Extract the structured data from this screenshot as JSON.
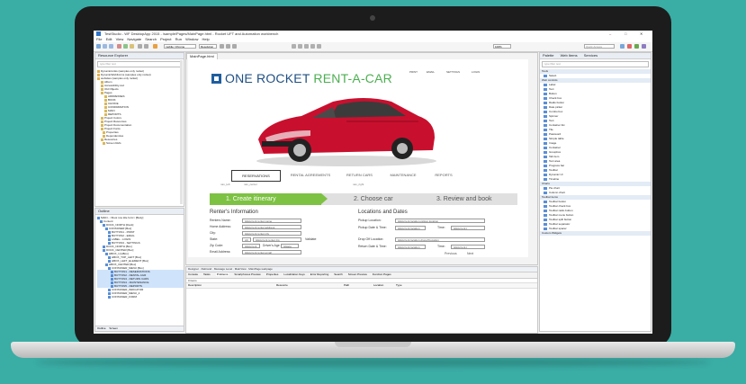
{
  "window": {
    "title": "TestStudio - WF DesktopApp 2015 - /sample/Pages/MainPage.html - Rocket UFT and Automation workbench",
    "controls": [
      "–",
      "□",
      "✕"
    ]
  },
  "menu": [
    "File",
    "Edit",
    "View",
    "Navigate",
    "Search",
    "Project",
    "Run",
    "Window",
    "Help"
  ],
  "toolbar": {
    "browser": "mobile: Chrome",
    "resolution": "Resolution",
    "zoom": "100%",
    "quick_access": "Quick Access"
  },
  "resource_explorer": {
    "title": "Resource Explorer",
    "search_placeholder": "type filter text",
    "items": [
      "DynamicLinks (samples only rocket)",
      "DynamicWebForms (samples only rocket)",
      "websites (samples only rocket)",
      "Album",
      "Accessibility.xsd",
      "Old Objects",
      "Pages",
      "ADDRESSES",
      "BOOK",
      "CHOICE",
      "CONFIRMATION",
      "MAIN",
      "REPORTS",
      "Project Colors",
      "Project Resources",
      "Project Documentation",
      "Project Fonts",
      "Properties",
      "Dependencies",
      "Resources",
      "Screen Refs"
    ]
  },
  "outline": {
    "title": "Outline",
    "items": [
      "MAIN - <Root row title form> [Body]",
      "Content",
      "DOCK_NORTH [Dock]",
      "CONTAINER [Box]",
      "BUTTON1 - PRINT",
      "BUTTON2 - EMAIL",
      "LABEL - LOGIN",
      "BUTTON3 - SETTINGS",
      "DOCK_NORTH [Box]",
      "DOCK_CENTER [Box]",
      "HBOX_1 [HBox]",
      "HBOX_TOP_LEFT [Box]",
      "HBOX_LEFT_ELEMENT [Box]",
      "HBOX_CENTER [Box]",
      "CONTAINER_MENU [Box]",
      "BUTTON1 - RESERVATIONS",
      "BUTTON2 - RENTAL AGR",
      "BUTTON3 - RETURN CARS",
      "BUTTON4 - MAINTENANCE",
      "BUTTON5 - REPORTS",
      "CONTAINER_INDICATOR",
      "CONTAINER_MENU_2",
      "CONTAINER_FORM"
    ],
    "footer_tabs": [
      "Outline",
      "Screen"
    ]
  },
  "editor": {
    "tab": "MainPage.html",
    "site": {
      "logo_one": "ONE ROCKET",
      "logo_rent": "RENT-A-CAR",
      "topnav": [
        "PRINT",
        "EMAIL",
        "SETTINGS",
        "LOGIN"
      ],
      "nav": [
        "RESERVATIONS",
        "RENTAL AGREEMENTS",
        "RETURN CARS",
        "MAINTENANCE",
        "REPORTS"
      ],
      "nav_sub": [
        "nav_left",
        "nav_center",
        "nav_right"
      ],
      "steps": [
        "1. Create itinerary",
        "2. Choose car",
        "3. Review and book"
      ],
      "renter": {
        "title": "Renter's Information",
        "fields": [
          {
            "label": "Renters Name:",
            "value": "&&current.renter.name"
          },
          {
            "label": "Home Address:",
            "value": "&&current.renter.address"
          },
          {
            "label": "City:",
            "value": "&&current.renter.city"
          },
          {
            "label": "State:",
            "value": "&&current.renter.zip"
          },
          {
            "label": "Zip Code:",
            "value": "&&current"
          },
          {
            "label": "Email Address:",
            "value": "&&current.renter.email"
          },
          {
            "label": "Additional Drivers:",
            "value": "Yes  No"
          }
        ],
        "state_code": "AK",
        "validate": "Validate",
        "drivers_age": "Driver's Age",
        "age_select": "&&age"
      },
      "locations": {
        "title": "Locations and Dates",
        "pickup_location": "Pickup Location:",
        "pickup_value": "&&current.location.pickup.location",
        "pickup_date": "Pickup Date & Time:",
        "pickup_date_value": "&&current.location",
        "time_label": "Time:",
        "time_value": "&&current.t",
        "dropoff_location": "Drop Off Location:",
        "dropoff_value": "&&current.location.dropoff.location",
        "return_date": "Return Date & Time:",
        "return_date_value": "&&current.location",
        "return_time_value": "&&current.t",
        "previous": "Previous",
        "next": "Next"
      },
      "directions": {
        "title": "Directions",
        "select": "COMBOBOX"
      }
    }
  },
  "bottom_panel": {
    "breadcrumb": "Designer · Rebrand · Message Level · MainView · MainPage.webpage",
    "tabs": [
      "Console",
      "Tasks",
      "Problems",
      "Smartphones Preview",
      "Properties",
      "Localization Keys",
      "Error Reporting",
      "Search",
      "Screen Preview",
      "Function Pages"
    ],
    "items_label": "0 items",
    "columns": [
      "Description",
      "Resource",
      "Path",
      "Location",
      "Type"
    ]
  },
  "palette": {
    "title": "Palette",
    "tabs": [
      "Palette",
      "Web Items",
      "Services"
    ],
    "search_placeholder": "type filter text",
    "sections": [
      {
        "name": "Tools",
        "items": [
          "Select"
        ]
      },
      {
        "name": "Web controls",
        "items": [
          "Label",
          "Text",
          "Button",
          "Check box",
          "Radio button",
          "Date picker",
          "Combo box",
          "Spinner",
          "Text",
          "Container list",
          "Tile",
          "Password",
          "Simple table",
          "Image",
          "Container",
          "Groupbox",
          "Tab item",
          "Text area",
          "Progress bar",
          "Toolbar",
          "Dynamic UI",
          "Timeline"
        ]
      },
      {
        "name": "Charts",
        "items": [
          "Pie chart",
          "Column chart"
        ]
      },
      {
        "name": "Toolbar items",
        "items": [
          "Toolbar button",
          "Toolbar check box",
          "Toolbar radio button",
          "Toolbar menu button",
          "Toolbar split button",
          "Toolbar separator",
          "Toolbar spacer"
        ]
      },
      {
        "name": "Custom Widgets",
        "items": []
      }
    ]
  },
  "colors": {
    "background": "#3aada5",
    "brand_blue": "#1f4f82",
    "brand_green": "#4caf50",
    "step_active": "#7dc242",
    "car_red": "#c8102e"
  }
}
